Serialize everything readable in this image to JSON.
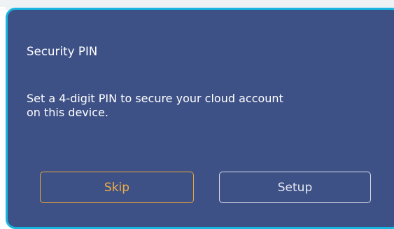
{
  "dialog": {
    "title": "Security PIN",
    "message_line1": "Set a 4-digit PIN to secure your cloud account",
    "message_line2": "on this device.",
    "skip_label": "Skip",
    "setup_label": "Setup"
  },
  "colors": {
    "dialog_background": "#3e5187",
    "dialog_border": "#18b6e0",
    "skip_accent": "#f0ad45",
    "setup_border": "#d7dbe6",
    "text": "#ffffff"
  }
}
